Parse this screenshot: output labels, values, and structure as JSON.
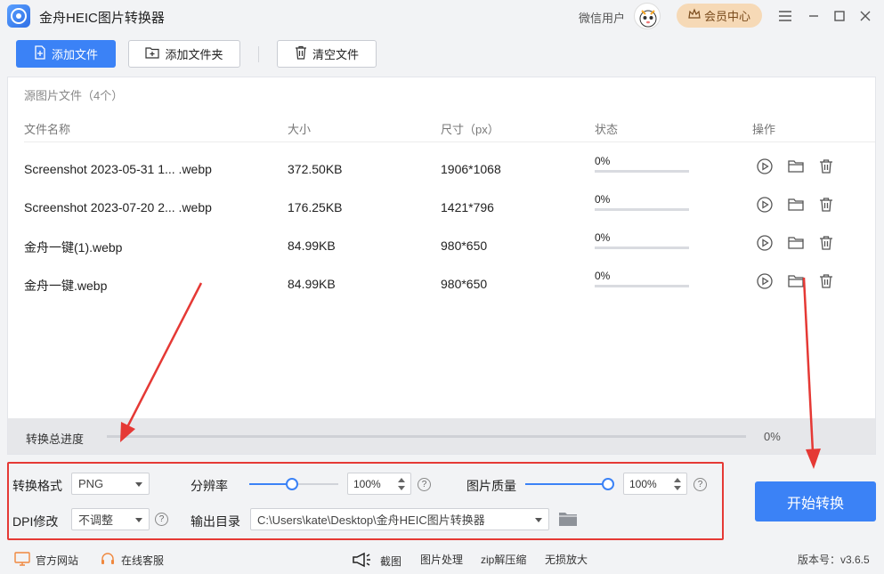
{
  "app": {
    "title": "金舟HEIC图片转换器"
  },
  "user": {
    "name": "微信用户",
    "vip_label": "会员中心"
  },
  "toolbar": {
    "add_file": "添加文件",
    "add_folder": "添加文件夹",
    "clear_files": "清空文件"
  },
  "file_list": {
    "title": "源图片文件（4个）",
    "columns": {
      "name": "文件名称",
      "size": "大小",
      "dimensions": "尺寸（px）",
      "status": "状态",
      "actions": "操作"
    },
    "rows": [
      {
        "name": "Screenshot 2023-05-31 1... .webp",
        "size": "372.50KB",
        "dimensions": "1906*1068",
        "status": "0%",
        "progress": 0
      },
      {
        "name": "Screenshot 2023-07-20 2... .webp",
        "size": "176.25KB",
        "dimensions": "1421*796",
        "status": "0%",
        "progress": 0
      },
      {
        "name": "金舟一键(1).webp",
        "size": "84.99KB",
        "dimensions": "980*650",
        "status": "0%",
        "progress": 0
      },
      {
        "name": "金舟一键.webp",
        "size": "84.99KB",
        "dimensions": "980*650",
        "status": "0%",
        "progress": 0
      }
    ]
  },
  "overall_progress": {
    "label": "转换总进度",
    "value": "0%",
    "fraction": 0
  },
  "settings": {
    "format_label": "转换格式",
    "format_value": "PNG",
    "resolution_label": "分辨率",
    "resolution_value": "100%",
    "resolution_fraction": 1.0,
    "quality_label": "图片质量",
    "quality_value": "100%",
    "quality_fraction": 1.0,
    "dpi_label": "DPI修改",
    "dpi_value": "不调整",
    "output_label": "输出目录",
    "output_value": "C:\\Users\\kate\\Desktop\\金舟HEIC图片转换器",
    "help_glyph": "?"
  },
  "start_button": "开始转换",
  "footer": {
    "website": "官方网站",
    "support": "在线客服",
    "screenshot": "截图",
    "image_processing": "图片处理",
    "zip": "zip解压缩",
    "upscale": "无损放大",
    "version": "版本号：v3.6.5"
  },
  "colors": {
    "accent": "#3b82f6",
    "highlight_red": "#e53935",
    "vip_bg": "#f6d9b6"
  }
}
